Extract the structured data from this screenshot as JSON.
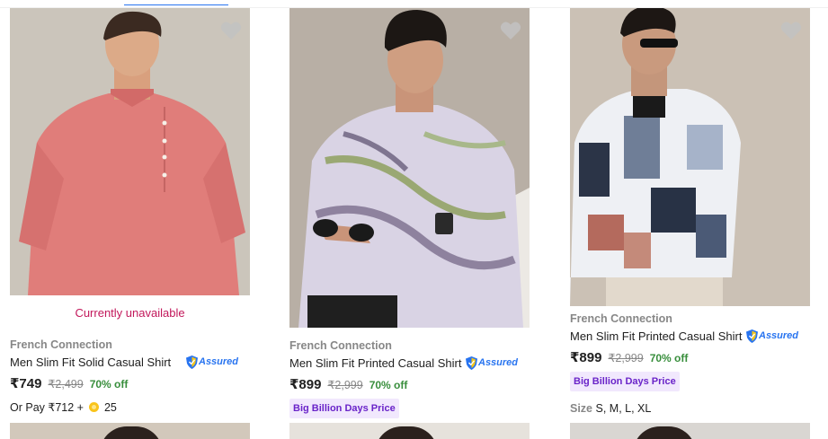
{
  "wishlist_icon": "heart-icon",
  "assured_icon": "shield-check-icon",
  "products": [
    {
      "unavailable_text": "Currently unavailable",
      "brand": "French Connection",
      "title": "Men Slim Fit Solid Casual Shirt",
      "assured": "Assured",
      "price": "₹749",
      "mrp": "₹2,499",
      "discount": "70% off",
      "or_pay_text": "Or Pay ₹712 +",
      "coins": "25",
      "shirt_color": "#e07d7a"
    },
    {
      "brand": "French Connection",
      "title": "Men Slim Fit Printed Casual Shirt",
      "assured": "Assured",
      "price": "₹899",
      "mrp": "₹2,999",
      "discount": "70% off",
      "badge": "Big Billion Days Price",
      "shirt_color": "#d9d3e4"
    },
    {
      "brand": "French Connection",
      "title": "Men Slim Fit Printed Casual Shirt",
      "assured": "Assured",
      "price": "₹899",
      "mrp": "₹2,999",
      "discount": "70% off",
      "badge": "Big Billion Days Price",
      "size_label": "Size",
      "sizes": "S, M, L, XL",
      "shirt_color": "#eef0f4"
    }
  ],
  "colors": {
    "unavailable": "#c2185b",
    "discount": "#388e3c",
    "badge_bg": "#f1e8fd",
    "badge_text": "#6a24c9",
    "assured": "#2874f0"
  }
}
